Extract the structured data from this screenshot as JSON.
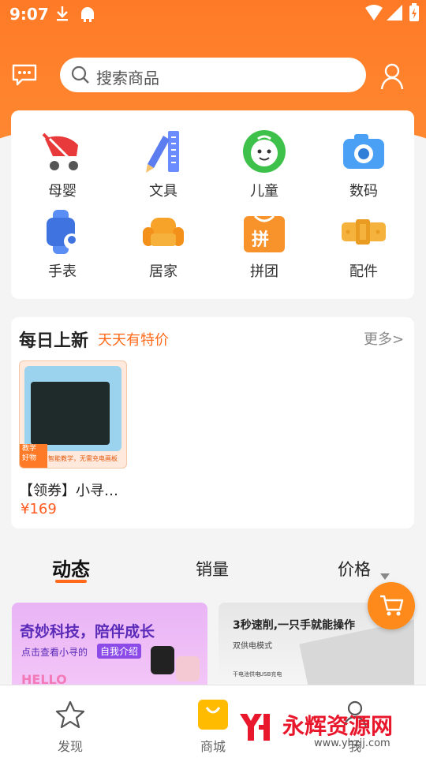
{
  "status_bar": {
    "time": "9:07"
  },
  "search": {
    "placeholder": "搜索商品"
  },
  "categories": [
    {
      "label": "母婴",
      "icon": "stroller-icon"
    },
    {
      "label": "文具",
      "icon": "pencil-ruler-icon"
    },
    {
      "label": "儿童",
      "icon": "child-face-icon"
    },
    {
      "label": "数码",
      "icon": "camera-icon"
    },
    {
      "label": "手表",
      "icon": "watch-icon"
    },
    {
      "label": "居家",
      "icon": "sofa-icon"
    },
    {
      "label": "拼团",
      "icon": "group-buy-bag-icon",
      "badge": "拼"
    },
    {
      "label": "配件",
      "icon": "strap-icon"
    }
  ],
  "daily_new": {
    "title": "每日上新",
    "subtitle": "天天有特价",
    "more": "更多>",
    "product": {
      "name": "【领券】小寻…",
      "price": "¥169",
      "img_corner_text": "教学\n好物",
      "img_bottom_text": "智能教学，无需充电画板"
    }
  },
  "sort_tabs": [
    {
      "label": "动态",
      "active": true
    },
    {
      "label": "销量",
      "active": false
    },
    {
      "label": "价格",
      "active": false,
      "has_arrow": true
    }
  ],
  "feed": [
    {
      "headline": "奇妙科技，陪伴成长",
      "sub_prefix": "点击查看小寻的",
      "sub_highlight": "自我介绍",
      "deco": "HELLO"
    },
    {
      "headline": "3秒速削,一只手就能操作",
      "sub": "双供电模式",
      "f1": "干电池供电",
      "f2": "USB充电"
    }
  ],
  "bottom_nav": [
    {
      "label": "发现",
      "icon": "star-icon"
    },
    {
      "label": "商城",
      "icon": "shopping-bag-icon"
    },
    {
      "label": "我",
      "icon": "user-icon"
    }
  ],
  "watermark": {
    "brand": "永辉资源网",
    "url": "www.yhzjj.com"
  },
  "colors": {
    "accent": "#ff7a26",
    "price": "#ff5a1f"
  }
}
